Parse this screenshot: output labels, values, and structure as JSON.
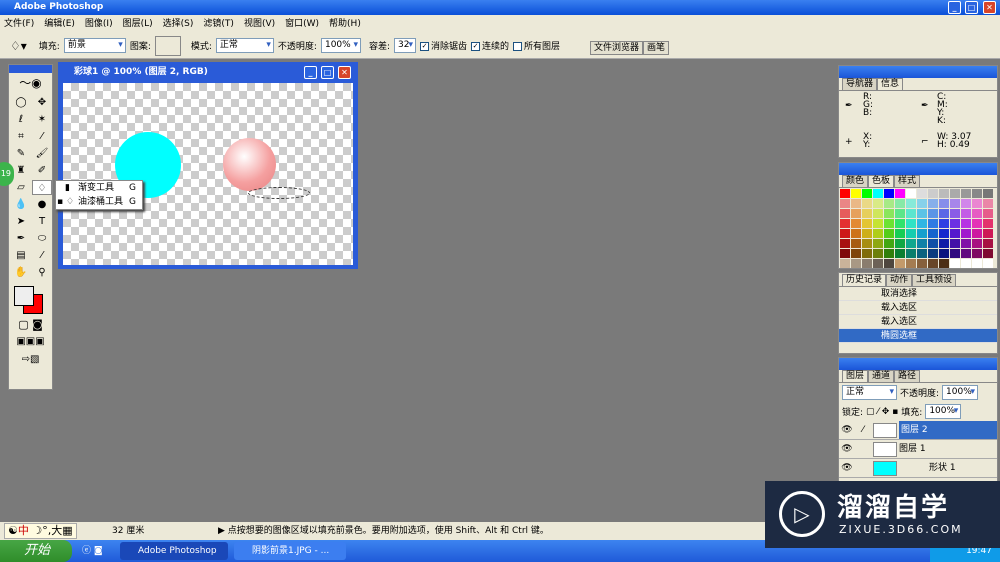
{
  "window": {
    "title": "Adobe Photoshop"
  },
  "menu": [
    "文件(F)",
    "编辑(E)",
    "图像(I)",
    "图层(L)",
    "选择(S)",
    "滤镜(T)",
    "视图(V)",
    "窗口(W)",
    "帮助(H)"
  ],
  "options": {
    "fill_label": "填充:",
    "fill_value": "前景",
    "pattern_label": "图案:",
    "mode_label": "模式:",
    "mode_value": "正常",
    "opacity_label": "不透明度:",
    "opacity_value": "100%",
    "tolerance_label": "容差:",
    "tolerance_value": "32",
    "antialias": "消除锯齿",
    "antialias_checked": true,
    "contiguous": "连续的",
    "contiguous_checked": true,
    "all_layers": "所有图层",
    "all_layers_checked": false,
    "tab_file_browser": "文件浏览器",
    "tab_brushes": "画笔"
  },
  "document": {
    "title": "彩球1 @ 100% (图层 2, RGB)",
    "colors": {
      "circle": "#00ffff",
      "sphere": "#f5a0a0"
    }
  },
  "flyout": [
    {
      "label": "渐变工具",
      "key": "G"
    },
    {
      "label": "油漆桶工具",
      "key": "G"
    }
  ],
  "badge": "19",
  "info_panel": {
    "tabs": [
      "导航器",
      "信息"
    ],
    "rgb": "R:\nG:\nB:",
    "cmyk": "C:\nM:\nY:\nK:",
    "xy": "X:\nY:",
    "w_label": "W:",
    "w": "3.07",
    "h_label": "H:",
    "h": "0.49"
  },
  "swatches_panel": {
    "tabs": [
      "颜色",
      "色板",
      "样式"
    ]
  },
  "history_panel": {
    "tabs": [
      "历史记录",
      "动作",
      "工具预设"
    ],
    "items": [
      "取消选择",
      "载入选区",
      "载入选区",
      "椭圆选框"
    ]
  },
  "layers_panel": {
    "tabs": [
      "图层",
      "通道",
      "路径"
    ],
    "blend": "正常",
    "opacity_label": "不透明度:",
    "opacity": "100%",
    "lock_label": "锁定:",
    "fill_label": "填充:",
    "fill": "100%",
    "layers": [
      "图层 2",
      "图层 1",
      "形状 1"
    ]
  },
  "status": {
    "ime": "中",
    "size": "32 厘米",
    "hint": "点按想要的图像区域以填充前景色。要用附加选项，使用 Shift、Alt 和 Ctrl 键。"
  },
  "taskbar": {
    "start": "开始",
    "tasks": [
      "Adobe Photoshop",
      "阴影前景1.JPG - ..."
    ],
    "clock": "19:47"
  },
  "watermark": {
    "name": "溜溜自学",
    "url": "ZIXUE.3D66.COM"
  }
}
